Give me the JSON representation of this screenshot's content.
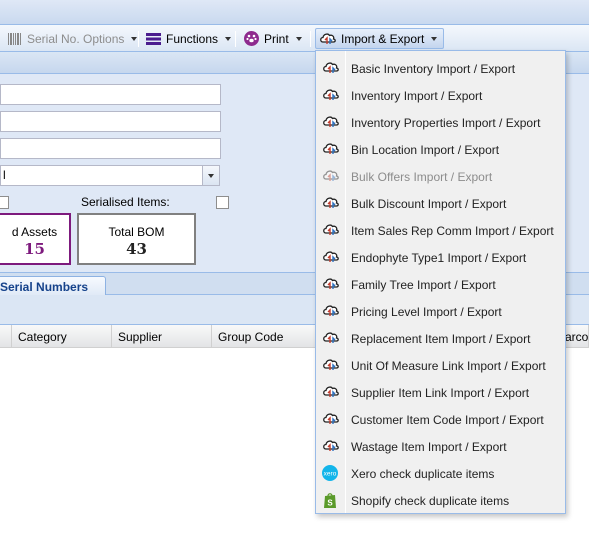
{
  "toolbar": {
    "serial_label": "Serial No. Options",
    "functions_label": "Functions",
    "print_label": "Print",
    "import_export_label": "Import & Export"
  },
  "form": {
    "combo_value": "l",
    "serialised_label": "Serialised Items:"
  },
  "cards": [
    {
      "title": "d Assets",
      "value": "15",
      "color": "#7d1a7d"
    },
    {
      "title": "Total BOM",
      "value": "43",
      "color": "#808080"
    }
  ],
  "tabs": {
    "serial_numbers": "Serial Numbers"
  },
  "grid": {
    "columns": [
      "Category",
      "Supplier",
      "Group Code",
      "arcod"
    ]
  },
  "menu": {
    "items": [
      {
        "label": "Basic Inventory Import / Export",
        "icon": "cloud-sync-icon",
        "disabled": false
      },
      {
        "label": "Inventory Import / Export",
        "icon": "cloud-sync-icon",
        "disabled": false
      },
      {
        "label": "Inventory Properties Import / Export",
        "icon": "cloud-sync-icon",
        "disabled": false
      },
      {
        "label": "Bin Location Import / Export",
        "icon": "cloud-sync-icon",
        "disabled": false
      },
      {
        "label": "Bulk Offers Import / Export",
        "icon": "cloud-sync-icon",
        "disabled": true
      },
      {
        "label": "Bulk Discount Import / Export",
        "icon": "cloud-sync-icon",
        "disabled": false
      },
      {
        "label": "Item Sales Rep Comm Import / Export",
        "icon": "cloud-sync-icon",
        "disabled": false
      },
      {
        "label": "Endophyte Type1 Import / Export",
        "icon": "cloud-sync-icon",
        "disabled": false
      },
      {
        "label": "Family Tree Import / Export",
        "icon": "cloud-sync-icon",
        "disabled": false
      },
      {
        "label": "Pricing Level Import / Export",
        "icon": "cloud-sync-icon",
        "disabled": false
      },
      {
        "label": "Replacement Item Import / Export",
        "icon": "cloud-sync-icon",
        "disabled": false
      },
      {
        "label": "Unit Of Measure Link Import / Export",
        "icon": "cloud-sync-icon",
        "disabled": false
      },
      {
        "label": "Supplier Item Link Import / Export",
        "icon": "cloud-sync-icon",
        "disabled": false
      },
      {
        "label": "Customer Item Code Import / Export",
        "icon": "cloud-sync-icon",
        "disabled": false
      },
      {
        "label": "Wastage Item Import / Export",
        "icon": "cloud-sync-icon",
        "disabled": false
      },
      {
        "label": "Xero check duplicate items",
        "icon": "xero-icon",
        "disabled": false
      },
      {
        "label": "Shopify check duplicate items",
        "icon": "shopify-icon",
        "disabled": false
      }
    ]
  },
  "colors": {
    "panel_bg": "#dfe8f6",
    "accent_border": "#99bbe8",
    "functions_icon": "#4b1d8f",
    "print_icon": "#8e2a8e",
    "xero_blue": "#13b5ea",
    "shopify_green": "#5a9a2a"
  }
}
